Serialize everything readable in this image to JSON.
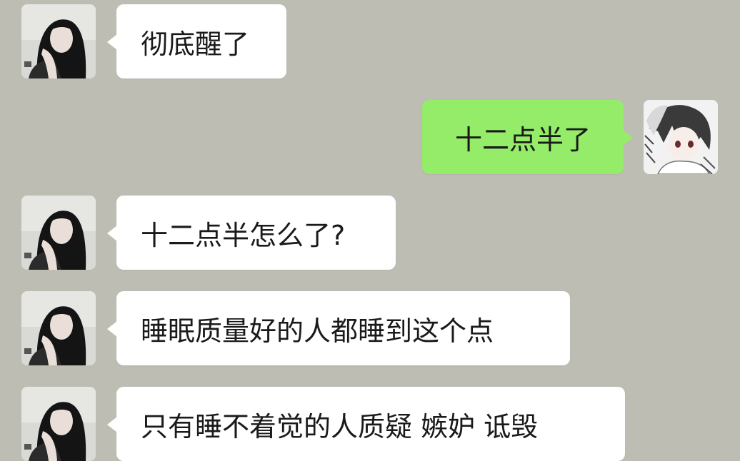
{
  "chat": {
    "messages": [
      {
        "sender": "contact",
        "text": "彻底醒了"
      },
      {
        "sender": "me",
        "text": "十二点半了"
      },
      {
        "sender": "contact",
        "text": "十二点半怎么了?"
      },
      {
        "sender": "contact",
        "text": "睡眠质量好的人都睡到这个点"
      },
      {
        "sender": "contact",
        "text": "只有睡不着觉的人质疑 嫉妒 诋毁"
      }
    ]
  },
  "colors": {
    "background": "#bdbdb4",
    "incoming_bubble": "#ffffff",
    "outgoing_bubble": "#95ec69",
    "text": "#1a1a1a"
  },
  "icons": {
    "contact_avatar": "contact-avatar-icon",
    "my_avatar": "my-avatar-icon"
  }
}
